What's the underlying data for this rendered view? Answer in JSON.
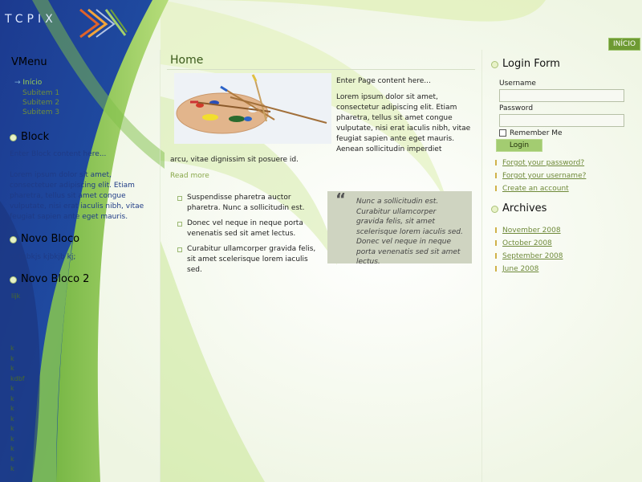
{
  "logo": {
    "text": "TCPIX"
  },
  "top_button": "INÍCIO",
  "left": {
    "vmenu_title": "VMenu",
    "nav_items": [
      "Início",
      "Subitem 1",
      "Subitem 2",
      "Subitem 3"
    ],
    "block_title": "Block",
    "block_intro": "Enter Block content here...",
    "block_text": "Lorem ipsum dolor sit amet, consectetuer adipiscing elit. Etiam pharetra, tellus sit amet congue vulputate, nisi erat iaculis nibh, vitae feugiat sapien ante eget mauris.",
    "bloco1_title": "Novo Bloco",
    "bloco1_text": "ajdjsbkjs kjbkjb kj;",
    "bloco2_title": "Novo Bloco 2",
    "bloco2_line1": "lijk",
    "k_items": [
      "k",
      "k",
      "k",
      "kdbf",
      "k",
      "k",
      "k",
      "k",
      "k",
      "k",
      "k",
      "k",
      "k"
    ]
  },
  "center": {
    "page_title": "Home",
    "intro": "Enter Page content here...",
    "para_right": "Lorem ipsum dolor sit amet, consectetur adipiscing elit. Etiam pharetra, tellus sit amet congue vulputate, nisi erat iaculis nibh, vitae feugiat sapien ante eget mauris. Aenean sollicitudin imperdiet",
    "para_full": "arcu, vitae dignissim sit posuere id.",
    "read_more": "Read more",
    "list": [
      "Suspendisse pharetra auctor pharetra. Nunc a sollicitudin est.",
      "Donec vel neque in neque porta venenatis sed sit amet lectus.",
      "Curabitur ullamcorper gravida felis, sit amet scelerisque lorem iaculis sed."
    ],
    "quote_mark": "“",
    "quote": "Nunc a sollicitudin est. Curabitur ullamcorper gravida felis, sit amet scelerisque lorem iaculis sed. Donec vel neque in neque porta venenatis sed sit amet lectus."
  },
  "right": {
    "login_title": "Login Form",
    "username_label": "Username",
    "password_label": "Password",
    "remember_label": "Remember Me",
    "login_button": "Login",
    "links": [
      "Forgot your password?",
      "Forgot your username?",
      "Create an account"
    ],
    "archives_title": "Archives",
    "archives": [
      "November 2008",
      "October 2008",
      "September 2008",
      "June 2008"
    ]
  },
  "colors": {
    "accent_green": "#6e9a33",
    "link_green": "#6f8a3a",
    "nav_blue": "#1f3b86"
  }
}
